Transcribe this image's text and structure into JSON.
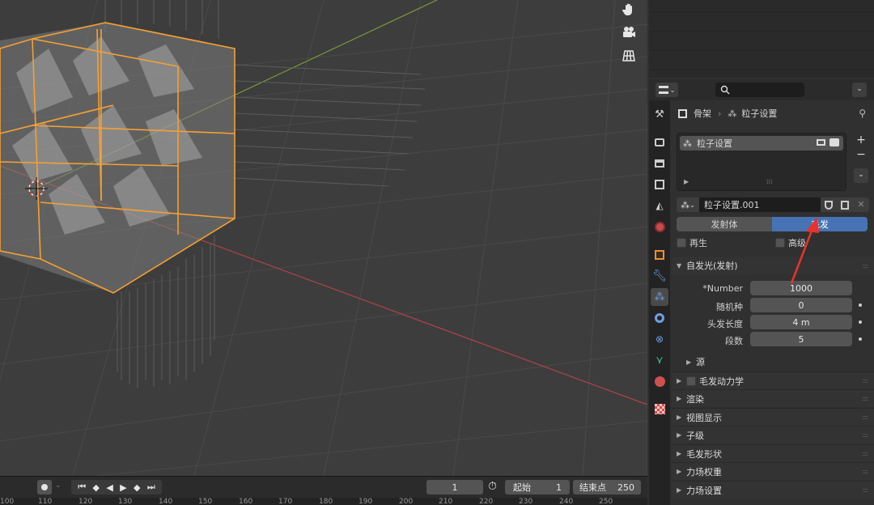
{
  "viewport": {
    "buttons": [
      "hand-icon",
      "camera-icon",
      "grid-view-icon"
    ]
  },
  "timeline": {
    "current_frame": "1",
    "start_label": "起始",
    "start_value": "1",
    "end_label": "结束点",
    "end_value": "250",
    "ruler": [
      "100",
      "110",
      "120",
      "130",
      "140",
      "150",
      "160",
      "170",
      "180",
      "190",
      "200",
      "210",
      "220",
      "230",
      "240",
      "250"
    ]
  },
  "properties": {
    "breadcrumb": {
      "object": "骨架",
      "separator": "›",
      "data": "粒子设置"
    },
    "particle_list": {
      "item": "粒子设置"
    },
    "settings_name": "粒子设置.001",
    "type_tabs": {
      "emitter": "发射体",
      "hair": "毛发"
    },
    "regrow_label": "再生",
    "advanced_label": "高级",
    "emission": {
      "title": "自发光(发射)",
      "number_label": "*Number",
      "number_value": "1000",
      "seed_label": "随机种",
      "seed_value": "0",
      "hair_length_label": "头发长度",
      "hair_length_value": "4 m",
      "segments_label": "段数",
      "segments_value": "5",
      "source_label": "源"
    },
    "panels": [
      "毛发动力学",
      "渲染",
      "视图显示",
      "子级",
      "毛发形状",
      "力场权重",
      "力场设置"
    ]
  },
  "colors": {
    "accent_blue": "#4772b3",
    "selection_orange": "#f5a033",
    "annotation_red": "#e8332a",
    "axis_red": "#b3414b",
    "axis_green": "#7a9a3a"
  }
}
